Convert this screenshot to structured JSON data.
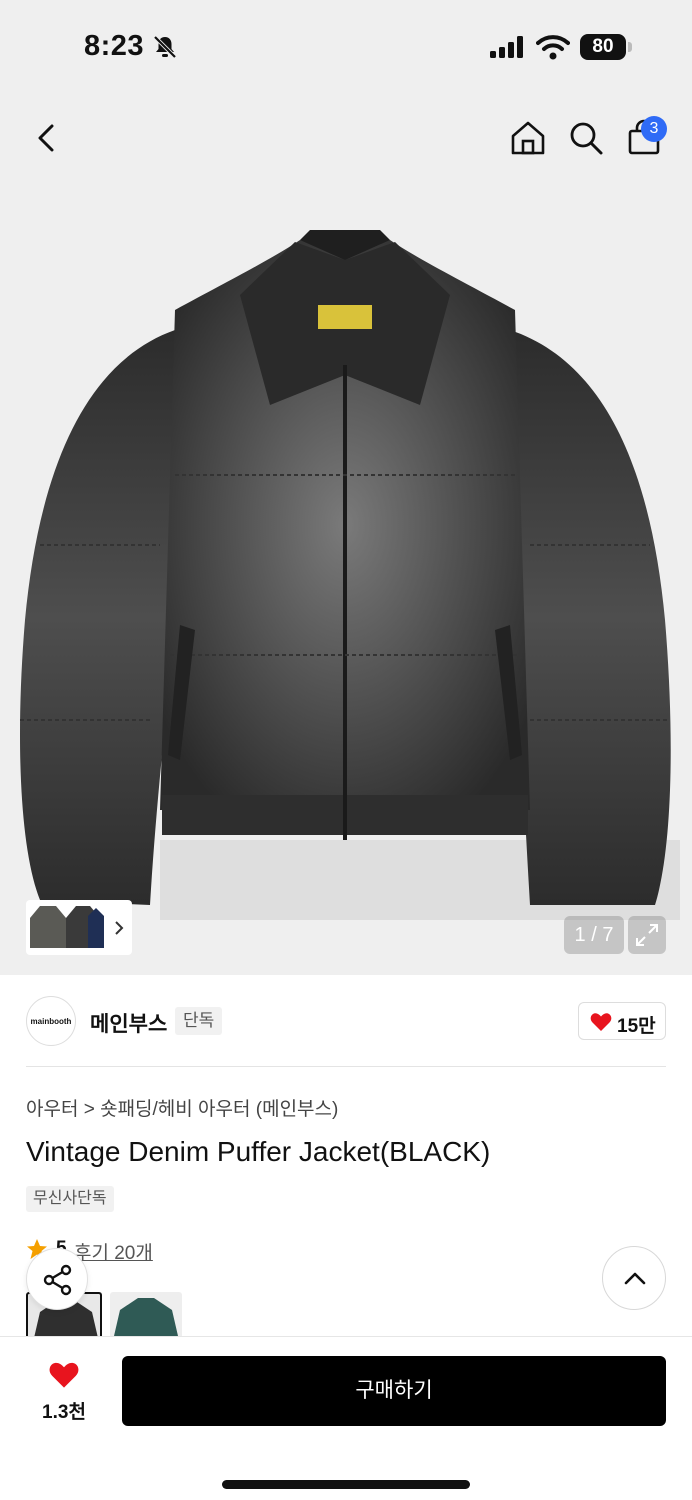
{
  "status_bar": {
    "time": "8:23",
    "battery": "80"
  },
  "nav": {
    "cart_count": "3"
  },
  "gallery": {
    "page_indicator": "1 / 7"
  },
  "brand": {
    "logo_text": "mainbooth",
    "name": "메인부스",
    "tag": "단독",
    "likes": "15만"
  },
  "product": {
    "category": "아우터 > 숏패딩/헤비 아우터 (메인부스)",
    "title": "Vintage Denim Puffer Jacket(BLACK)",
    "exclusive_tag": "무신사단독",
    "rating": "5",
    "review_link": "후기 20개"
  },
  "bottom_bar": {
    "likes": "1.3천",
    "buy_label": "구매하기"
  },
  "colors": {
    "accent_blue": "#2f6bf6",
    "heart_red": "#e8141e",
    "button_black": "#000000"
  }
}
